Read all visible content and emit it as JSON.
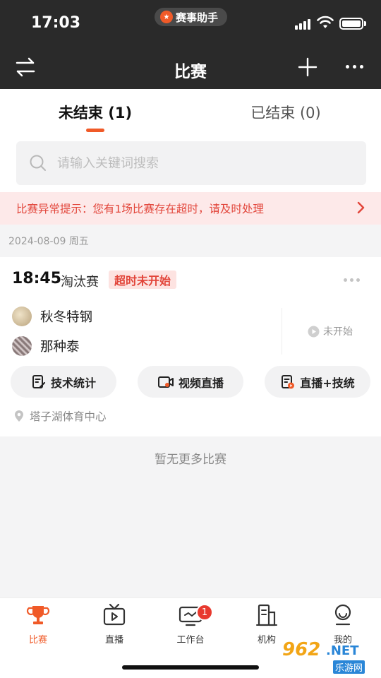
{
  "status_bar": {
    "time": "17:03",
    "app_pill": "赛事助手"
  },
  "nav": {
    "title": "比赛"
  },
  "tabs": [
    {
      "label": "未结束 (1)",
      "active": true
    },
    {
      "label": "已结束 (0)",
      "active": false
    }
  ],
  "search": {
    "placeholder": "请输入关键词搜索"
  },
  "alert": {
    "text": "比赛异常提示：您有1场比赛存在超时，请及时处理"
  },
  "date_header": "2024-08-09 周五",
  "match": {
    "time": "18:45",
    "round": "淘汰赛",
    "status_badge": "超时未开始",
    "teams": [
      {
        "name": "秋冬特钢"
      },
      {
        "name": "那种泰"
      }
    ],
    "state": "未开始",
    "actions": [
      {
        "label": "技术统计",
        "icon": "stats-edit-icon"
      },
      {
        "label": "视频直播",
        "icon": "video-camera-icon"
      },
      {
        "label": "直播+技统",
        "icon": "live-stats-icon"
      }
    ],
    "venue": "塔子湖体育中心"
  },
  "empty_note": "暂无更多比赛",
  "tabbar": [
    {
      "label": "比赛",
      "icon": "trophy-icon",
      "active": true
    },
    {
      "label": "直播",
      "icon": "tv-icon",
      "active": false
    },
    {
      "label": "工作台",
      "icon": "workbench-icon",
      "active": false,
      "badge": "1"
    },
    {
      "label": "机构",
      "icon": "building-icon",
      "active": false
    },
    {
      "label": "我的",
      "icon": "profile-icon",
      "active": false
    }
  ],
  "watermark": {
    "main": "962",
    "net": ".NET",
    "sub": "乐游网"
  },
  "colors": {
    "accent": "#f05a28",
    "alert_text": "#e2453a",
    "header_bg": "#2a2a2a"
  }
}
